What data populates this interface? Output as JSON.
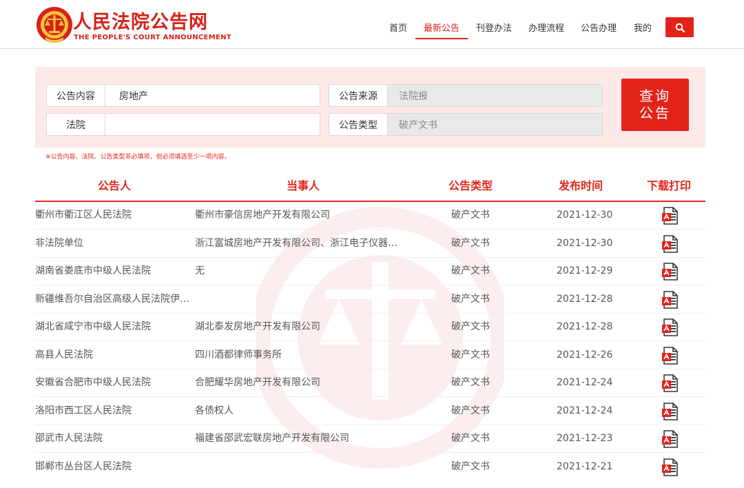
{
  "header": {
    "brand_cn": "人民法院公告网",
    "brand_en": "THE PEOPLE'S COURT ANNOUNCEMENT",
    "logo_icon": "court-emblem-icon",
    "nav": [
      {
        "label": "首页",
        "active": false
      },
      {
        "label": "最新公告",
        "active": true
      },
      {
        "label": "刊登办法",
        "active": false
      },
      {
        "label": "办理流程",
        "active": false
      },
      {
        "label": "公告办理",
        "active": false
      },
      {
        "label": "我的",
        "active": false
      }
    ],
    "search_icon": "search-icon"
  },
  "search": {
    "content_label": "公告内容",
    "content_value": "房地产",
    "court_label": "法院",
    "court_value": "",
    "source_label": "公告来源",
    "source_value": "法院报",
    "type_label": "公告类型",
    "type_value": "破产文书",
    "query_line1": "查询",
    "query_line2": "公告",
    "tip": "※公告内容、法院、公告类型非必填项，但必须填选至少一项内容。"
  },
  "table": {
    "headers": [
      "公告人",
      "当事人",
      "公告类型",
      "发布时间",
      "下载打印"
    ],
    "rows": [
      {
        "court": "衢州市衢江区人民法院",
        "party": "衢州市豪信房地产开发有限公司",
        "type": "破产文书",
        "date": "2021-12-30"
      },
      {
        "court": "非法院单位",
        "party": "浙江富城房地产开发有限公司、浙江电子仪器…",
        "type": "破产文书",
        "date": "2021-12-30"
      },
      {
        "court": "湖南省娄底市中级人民法院",
        "party": "无",
        "type": "破产文书",
        "date": "2021-12-29"
      },
      {
        "court": "新疆维吾尔自治区高级人民法院伊…",
        "party": "",
        "type": "破产文书",
        "date": "2021-12-28"
      },
      {
        "court": "湖北省咸宁市中级人民法院",
        "party": "湖北泰发房地产开发有限公司",
        "type": "破产文书",
        "date": "2021-12-28"
      },
      {
        "court": "高县人民法院",
        "party": "四川酒都律师事务所",
        "type": "破产文书",
        "date": "2021-12-26"
      },
      {
        "court": "安徽省合肥市中级人民法院",
        "party": "合肥耀华房地产开发有限公司",
        "type": "破产文书",
        "date": "2021-12-24"
      },
      {
        "court": "洛阳市西工区人民法院",
        "party": "各债权人",
        "type": "破产文书",
        "date": "2021-12-24"
      },
      {
        "court": "邵武市人民法院",
        "party": "福建省邵武宏联房地产开发有限公司",
        "type": "破产文书",
        "date": "2021-12-23"
      },
      {
        "court": "邯郸市丛台区人民法院",
        "party": "",
        "type": "破产文书",
        "date": "2021-12-21"
      }
    ],
    "download_icon": "pdf-icon"
  },
  "colors": {
    "accent": "#e2231a",
    "panel_bg": "#fde9e8"
  }
}
